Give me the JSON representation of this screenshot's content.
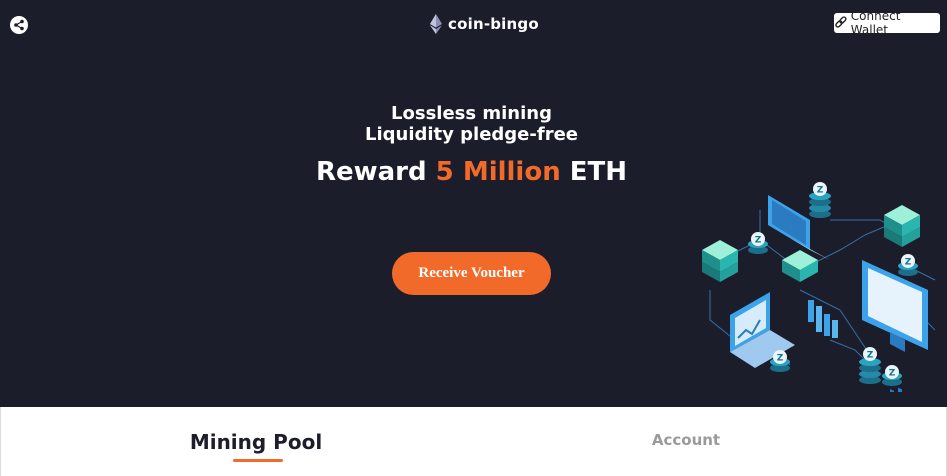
{
  "header": {
    "brand_name": "coin-bingo",
    "connect_label": "Connect Wallet",
    "share_icon": "share-icon",
    "brand_icon": "ethereum-icon",
    "wallet_icon": "link-icon"
  },
  "hero": {
    "line1": "Lossless mining",
    "line2": "Liquidity pledge-free",
    "reward_prefix": "Reward",
    "reward_amount": "5 Million",
    "reward_suffix": "ETH",
    "cta_label": "Receive Voucher",
    "illustration_icon": "blockchain-network-illustration",
    "node_glyph": "Z"
  },
  "tabs": [
    {
      "label": "Mining Pool",
      "active": true
    },
    {
      "label": "Account",
      "active": false
    }
  ],
  "colors": {
    "background": "#1c1d2b",
    "accent": "#f26a2a",
    "teal": "#2bb5b0",
    "blue": "#3ca3ea"
  }
}
